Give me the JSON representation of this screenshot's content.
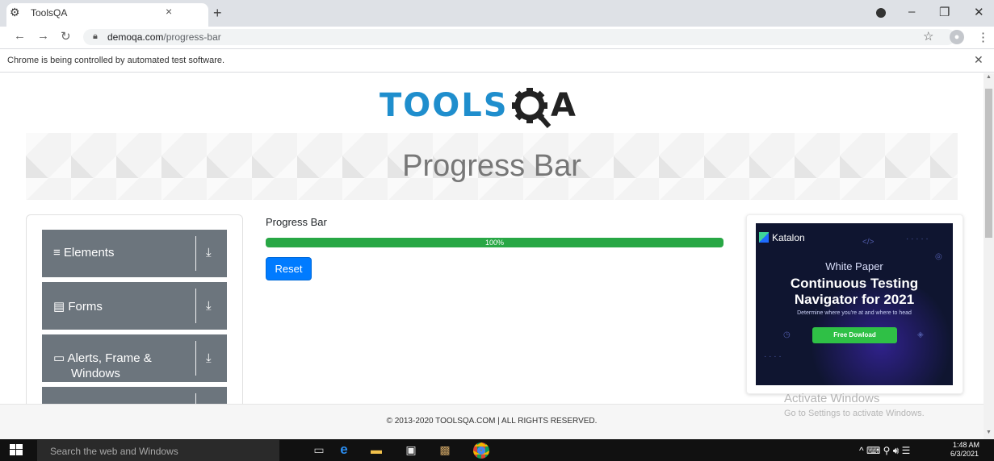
{
  "browser": {
    "tab_title": "ToolsQA",
    "tab_icon": "gear-icon",
    "close_glyph": "×",
    "newtab_glyph": "+",
    "url_host": "demoqa.com",
    "url_path": "/progress-bar",
    "automation_notice": "Chrome is being controlled by automated test software."
  },
  "header": {
    "logo_text_tools": "TOOLS",
    "logo_text_qa": "A"
  },
  "banner": {
    "title": "Progress Bar"
  },
  "sidebar": {
    "groups": [
      {
        "label": "Elements",
        "icon": "hamburger-icon"
      },
      {
        "label": "Forms",
        "icon": "document-icon"
      },
      {
        "label": "Alerts, Frame &",
        "label2": "Windows",
        "icon": "window-icon"
      }
    ]
  },
  "progress": {
    "label": "Progress Bar",
    "value": 100,
    "value_text": "100%",
    "reset_label": "Reset",
    "color": "#28a745"
  },
  "ad": {
    "brand": "Katalon",
    "kicker": "White Paper",
    "headline1": "Continuous Testing",
    "headline2": "Navigator for 2021",
    "subline": "Determine where you're at and where to head",
    "cta": "Free Dowload"
  },
  "footer": {
    "text": "© 2013-2020 TOOLSQA.COM | ALL RIGHTS RESERVED."
  },
  "watermark": {
    "title": "Activate Windows",
    "subtitle": "Go to Settings to activate Windows."
  },
  "taskbar": {
    "search_placeholder": "Search the web and Windows",
    "time": "1:48 AM",
    "date": "6/3/2021"
  },
  "colors": {
    "accent": "#007bff",
    "sidebar_group": "#6c757d",
    "logo_blue": "#1f8ecd"
  }
}
